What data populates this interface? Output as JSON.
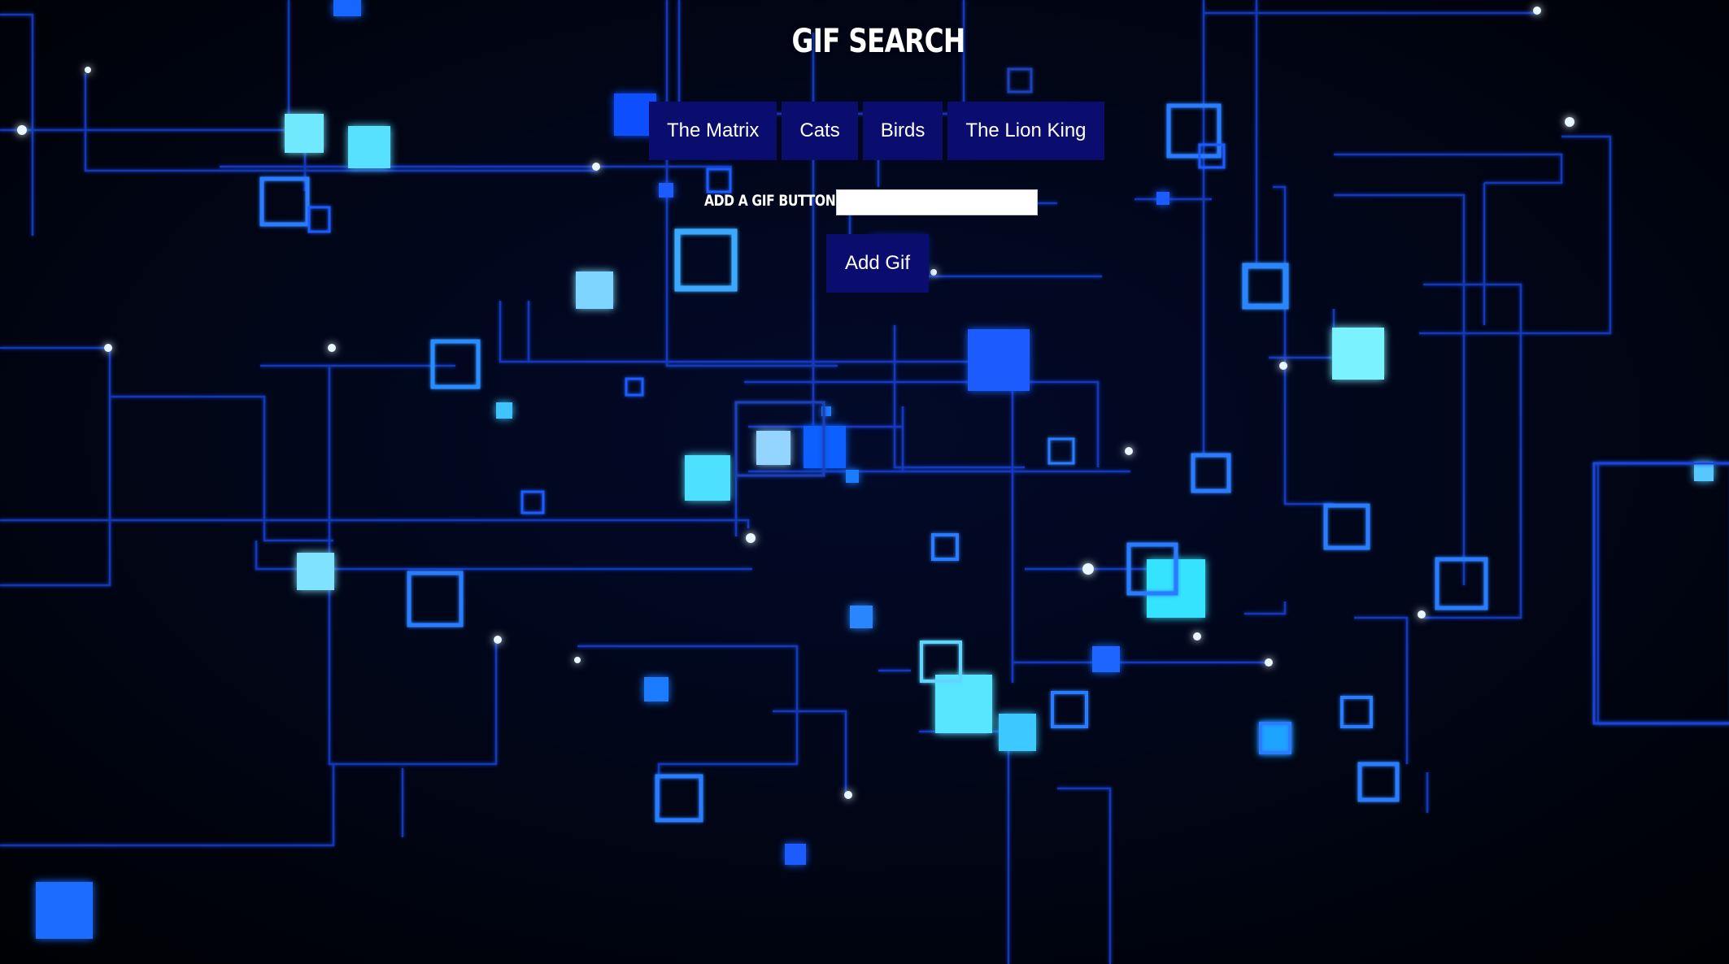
{
  "header": {
    "title": "GIF SEARCH"
  },
  "topics": [
    {
      "label": "The Matrix"
    },
    {
      "label": "Cats"
    },
    {
      "label": "Birds"
    },
    {
      "label": "The Lion King"
    }
  ],
  "add_form": {
    "label": "ADD A GIF BUTTON",
    "input_value": "",
    "submit_label": "Add Gif"
  },
  "colors": {
    "button_bg": "#0a0c6e",
    "button_text": "#ffffff",
    "background": "#000208",
    "circuit_blue": "#1e5bff",
    "circuit_cyan": "#5fe6ff"
  }
}
